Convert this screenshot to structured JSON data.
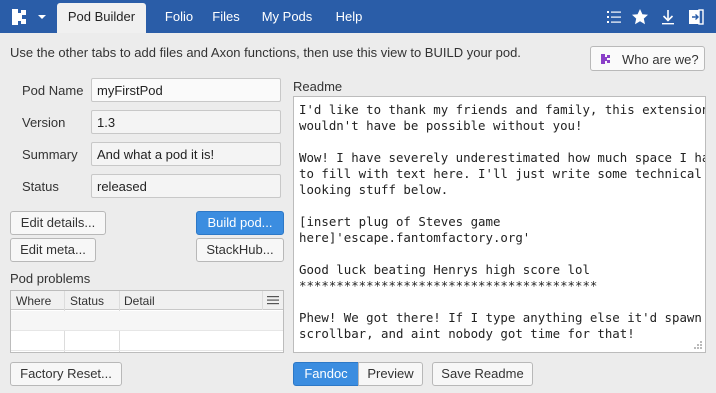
{
  "nav": {
    "tabs": [
      {
        "label": "Pod Builder",
        "active": true
      },
      {
        "label": "Folio",
        "active": false
      },
      {
        "label": "Files",
        "active": false
      },
      {
        "label": "My Pods",
        "active": false
      },
      {
        "label": "Help",
        "active": false
      }
    ],
    "right_icons": [
      "list-icon",
      "star-icon",
      "download-icon",
      "logout-icon"
    ]
  },
  "intro_text": "Use the other tabs to add files and Axon functions, then use this view to BUILD your pod.",
  "who_button": {
    "label": "Who are we?",
    "icon": "fantom-logo-icon"
  },
  "form": {
    "pod_name": {
      "label": "Pod Name",
      "value": "myFirstPod"
    },
    "version": {
      "label": "Version",
      "value": "1.3"
    },
    "summary": {
      "label": "Summary",
      "value": "And what a pod it is!"
    },
    "status": {
      "label": "Status",
      "value": "released"
    }
  },
  "buttons": {
    "edit_details": "Edit details...",
    "build_pod": "Build pod...",
    "edit_meta": "Edit meta...",
    "stackhub": "StackHub...",
    "factory_reset": "Factory Reset..."
  },
  "problems": {
    "title": "Pod problems",
    "columns": [
      "Where",
      "Status",
      "Detail"
    ]
  },
  "readme": {
    "label": "Readme",
    "text": "I'd like to thank my friends and family, this extension\nwouldn't have be possible without you!\n\nWow! I have severely underestimated how much space I had\nto fill with text here. I'll just write some technical\nlooking stuff below.\n\n[insert plug of Steves game\nhere]'escape.fantomfactory.org'\n\nGood luck beating Henrys high score lol\n****************************************\n\nPhew! We got there! If I type anything else it'd spawn a\nscrollbar, and aint nobody got time for that!"
  },
  "readme_modes": [
    {
      "label": "Fandoc",
      "active": true
    },
    {
      "label": "Preview",
      "active": false
    }
  ],
  "save_readme": "Save Readme",
  "colors": {
    "nav_bg": "#2a5da8",
    "primary": "#3b8de0",
    "logo": "#8a3fc8"
  }
}
